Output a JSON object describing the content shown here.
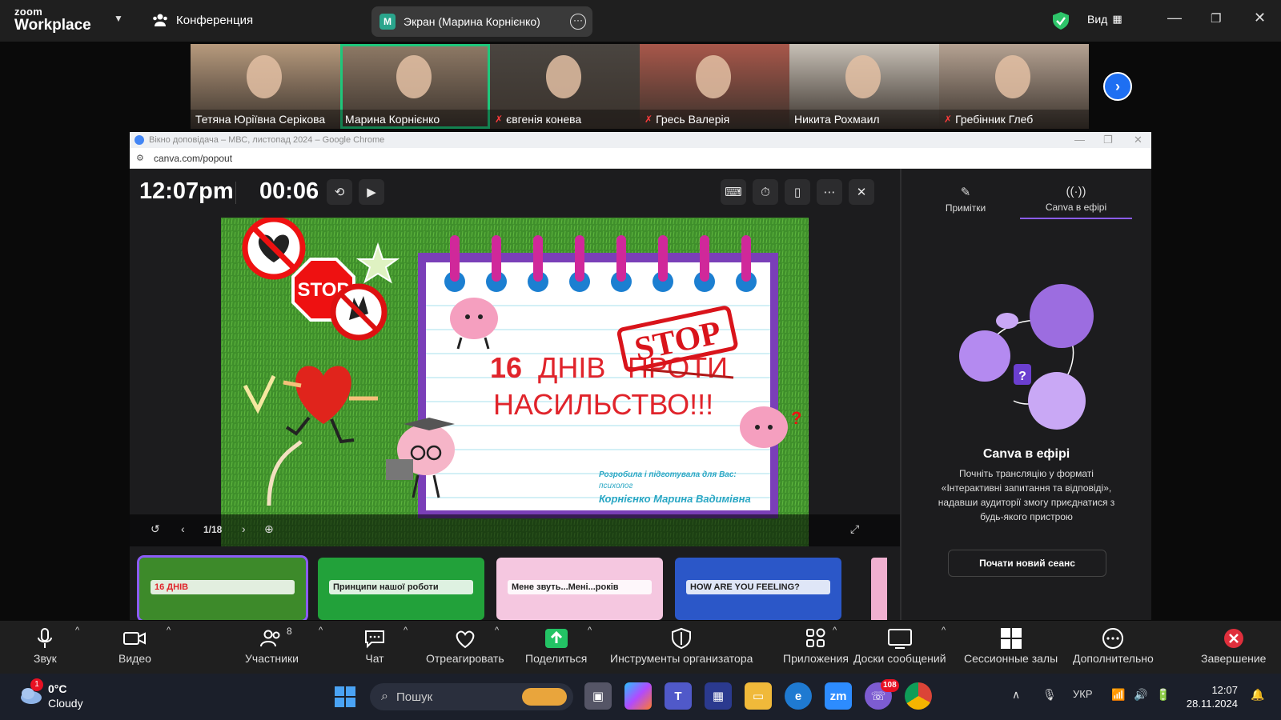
{
  "zoom": {
    "logo_small": "zoom",
    "logo_big": "Workplace",
    "conference_label": "Конференция",
    "share_initial": "M",
    "share_label": "Экран (Марина Корнієнко)",
    "view_label": "Вид"
  },
  "participants": [
    {
      "name": "Тетяна Юріївна Серікова",
      "muted": false,
      "active": false,
      "bg": "#b79a7d"
    },
    {
      "name": "Марина Корнієнко",
      "muted": false,
      "active": true,
      "bg": "#8f7a66"
    },
    {
      "name": "євгенія конева",
      "muted": true,
      "active": false,
      "bg": "#4a4540"
    },
    {
      "name": "Гресь Валерія",
      "muted": true,
      "active": false,
      "bg": "#a8574a"
    },
    {
      "name": "Никита Рохмаил",
      "muted": false,
      "active": false,
      "bg": "#c7c0b6"
    },
    {
      "name": "Гребінник Глеб",
      "muted": true,
      "active": false,
      "bg": "#b5a292"
    }
  ],
  "chrome": {
    "title": "Вікно доповідача – МВС, листопад 2024 – Google Chrome",
    "url": "canva.com/popout"
  },
  "presenter": {
    "clock": "12:07pm",
    "timer": "00:06",
    "page_indicator": "1/18"
  },
  "slide": {
    "stop_sign": "STOP",
    "stamp": "STOP",
    "title_line1_num": "16",
    "title_line1_a": "ДНІВ",
    "title_line1_b": "ПРОТИ",
    "title_line2": "НАСИЛЬСТВО!!!",
    "credit_line1": "Розробила і підготувала для Вас:",
    "credit_line2": "психолог",
    "credit_line3": "Корнієнко Марина Вадимівна"
  },
  "thumbnails": [
    {
      "label": "16 ДНІВ",
      "bg": "#3d8a2a",
      "sel": true
    },
    {
      "label": "Принципи нашої роботи",
      "bg": "#22a13a",
      "sel": false
    },
    {
      "label": "Мене звуть...Мені...років",
      "bg": "#f5c7e0",
      "sel": false
    },
    {
      "label": "HOW ARE YOU FEELING?",
      "bg": "#2b57c8",
      "sel": false
    }
  ],
  "panel": {
    "tab_notes": "Примітки",
    "tab_live": "Canva в ефірі",
    "heading": "Canva в ефірі",
    "description": "Почніть трансляцію у форматі «Інтерактивні запитання та відповіді», надавши аудиторії змогу приєднатися з будь-якого пристрою",
    "button": "Почати новий сеанс"
  },
  "toolbar": {
    "audio": "Звук",
    "video": "Видео",
    "participants": "Участники",
    "participants_count": "8",
    "chat": "Чат",
    "react": "Отреагировать",
    "share": "Поделиться",
    "host_tools": "Инструменты организатора",
    "apps": "Приложения",
    "boards": "Доски сообщений",
    "breakout": "Сессионные залы",
    "more": "Дополнительно",
    "end": "Завершение"
  },
  "taskbar": {
    "temp": "0°C",
    "weather": "Cloudy",
    "weather_badge": "1",
    "search_placeholder": "Пошук",
    "viber_badge": "108",
    "lang": "УКР",
    "time": "12:07",
    "date": "28.11.2024"
  }
}
